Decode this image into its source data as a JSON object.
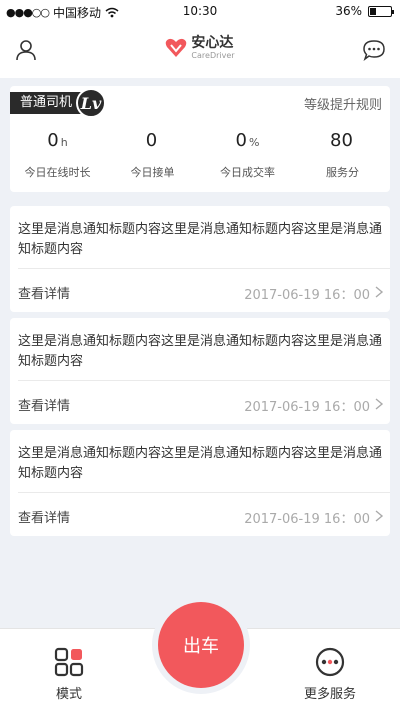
{
  "status_bar": {
    "signal": "●●●○○",
    "carrier": "中国移动",
    "time": "10:30",
    "battery": "36%"
  },
  "header": {
    "logo_cn": "安心达",
    "logo_en": "CareDriver"
  },
  "stats": {
    "level_name": "普通司机",
    "level_badge": "Lv",
    "upgrade_link": "等级提升规则",
    "items": [
      {
        "value": "0",
        "unit": "h",
        "label": "今日在线时长"
      },
      {
        "value": "0",
        "unit": "",
        "label": "今日接单"
      },
      {
        "value": "0",
        "unit": "%",
        "label": "今日成交率"
      },
      {
        "value": "80",
        "unit": "",
        "label": "服务分"
      }
    ]
  },
  "messages": [
    {
      "title": "这里是消息通知标题内容这里是消息通知标题内容这里是消息通知标题内容",
      "detail": "查看详情",
      "date": "2017-06-19 16：00"
    },
    {
      "title": "这里是消息通知标题内容这里是消息通知标题内容这里是消息通知标题内容",
      "detail": "查看详情",
      "date": "2017-06-19 16：00"
    },
    {
      "title": "这里是消息通知标题内容这里是消息通知标题内容这里是消息通知标题内容",
      "detail": "查看详情",
      "date": "2017-06-19 16：00"
    }
  ],
  "bottom": {
    "mode_label": "模式",
    "go_label": "出车",
    "more_label": "更多服务"
  },
  "colors": {
    "accent": "#f2585c",
    "badge": "#2a2a2a"
  }
}
